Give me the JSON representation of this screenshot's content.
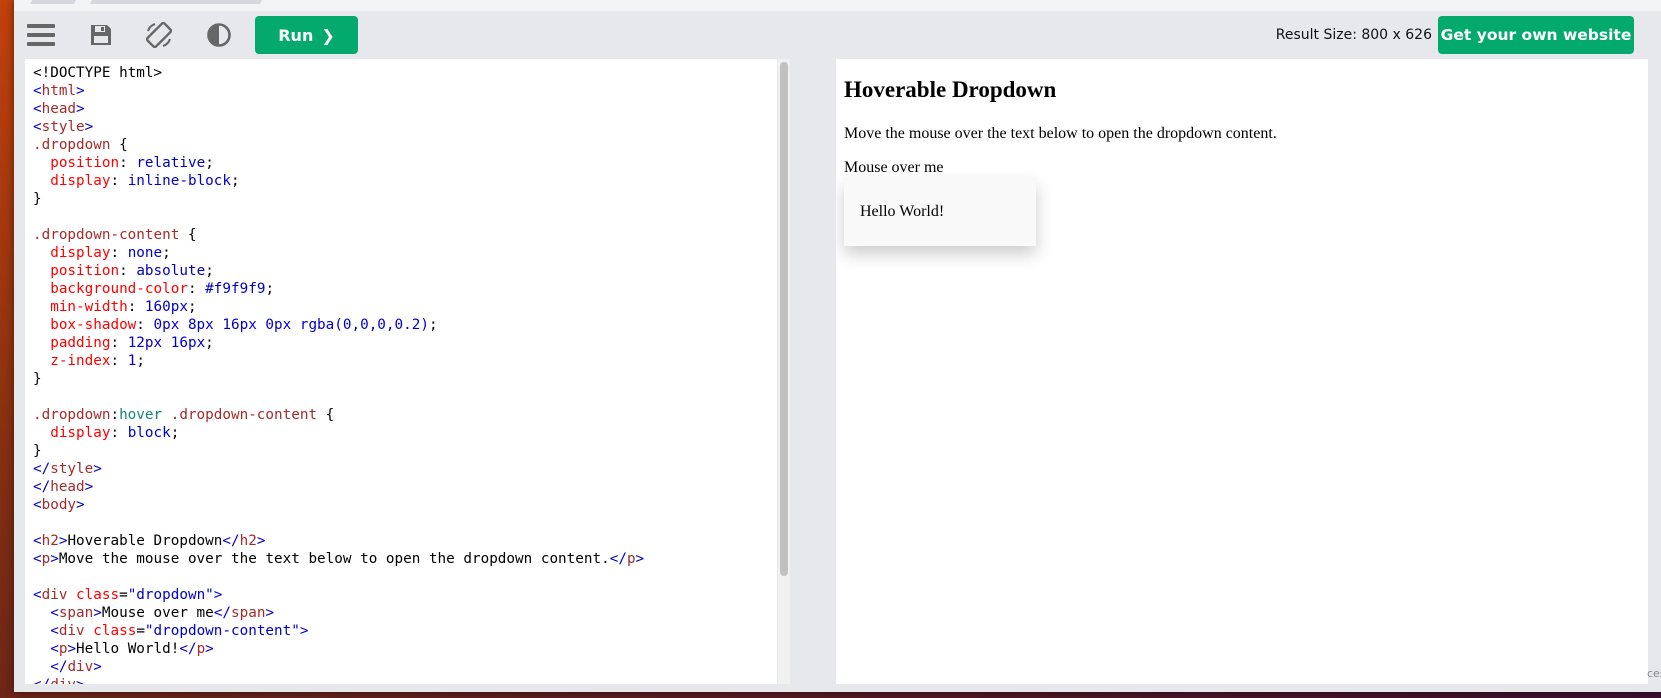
{
  "toolbar": {
    "icons": [
      "menu-icon",
      "save-icon",
      "rotate-icon",
      "contrast-icon"
    ],
    "run_label": "Run",
    "run_chevron": "❯",
    "result_size": "Result Size: 800 x 626",
    "own_website_label": "Get your own website"
  },
  "editor": {
    "lines": [
      "<!DOCTYPE html>",
      "<html>",
      "<head>",
      "<style>",
      ".dropdown {",
      "  position: relative;",
      "  display: inline-block;",
      "}",
      "",
      ".dropdown-content {",
      "  display: none;",
      "  position: absolute;",
      "  background-color: #f9f9f9;",
      "  min-width: 160px;",
      "  box-shadow: 0px 8px 16px 0px rgba(0,0,0,0.2);",
      "  padding: 12px 16px;",
      "  z-index: 1;",
      "}",
      "",
      ".dropdown:hover .dropdown-content {",
      "  display: block;",
      "}",
      "</style>",
      "</head>",
      "<body>",
      "",
      "<h2>Hoverable Dropdown</h2>",
      "<p>Move the mouse over the text below to open the dropdown content.</p>",
      "",
      "<div class=\"dropdown\">",
      "  <span>Mouse over me</span>",
      "  <div class=\"dropdown-content\">",
      "  <p>Hello World!</p>",
      "  </div>",
      "</div>"
    ]
  },
  "result": {
    "heading": "Hoverable Dropdown",
    "paragraph": "Move the mouse over the text below to open the dropdown content.",
    "hover_text": "Mouse over me",
    "dropdown_text": "Hello World!"
  },
  "corner_text": "ces",
  "colors": {
    "accent_green": "#04aa6d",
    "toolbar_bg": "#e6e8ec",
    "tag_blue": "#0000cd",
    "tag_name_brown": "#a52a2a",
    "property_red": "#ff0000",
    "pseudo_teal": "#118877"
  }
}
